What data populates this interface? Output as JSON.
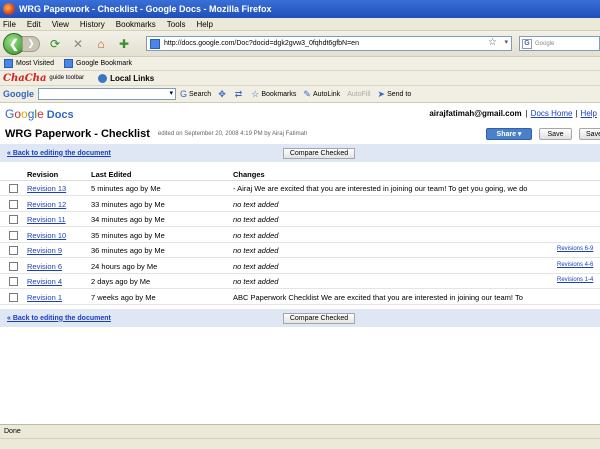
{
  "window": {
    "title": "WRG Paperwork - Checklist - Google Docs - Mozilla Firefox"
  },
  "menu": [
    "File",
    "Edit",
    "View",
    "History",
    "Bookmarks",
    "Tools",
    "Help"
  ],
  "nav": {
    "url": "http://docs.google.com/Doc?docid=dgk2gvw3_0fqhdt6gfbN=en",
    "search_placeholder": "Google"
  },
  "bookmarks": [
    "Most Visited",
    "Google Bookmark"
  ],
  "chacha": {
    "logo": "ChaCha",
    "subtitle": "guide toolbar",
    "local_links": "Local Links"
  },
  "google_toolbar": {
    "logo": "Google",
    "search": "Search",
    "bookmarks": "Bookmarks",
    "autolink": "AutoLink",
    "autofill": "AutoFill",
    "send_to": "Send to"
  },
  "docs_header": {
    "logo_letters": [
      "G",
      "o",
      "o",
      "g",
      "l",
      "e"
    ],
    "docs_label": "Docs",
    "user_email": "airajfatimah@gmail.com",
    "separator": "|",
    "docs_home": "Docs Home",
    "help": "Help"
  },
  "document": {
    "title": "WRG Paperwork - Checklist",
    "edited": "edited on September 20, 2008 4:19 PM by Airaj Fatimah",
    "share_label": "Share ▾",
    "save_label": "Save",
    "save_close_label": "Save"
  },
  "revisions": {
    "back_link": "« Back to editing the document",
    "compare_label": "Compare Checked",
    "headers": {
      "revision": "Revision",
      "last_edited": "Last Edited",
      "changes": "Changes"
    },
    "rows": [
      {
        "revision": "Revision 13",
        "edited": "5 minutes ago by Me",
        "changes": "- Airaj We are excited that you are interested in joining our team! To get you going, we do",
        "italic": false,
        "range": ""
      },
      {
        "revision": "Revision 12",
        "edited": "33 minutes ago by Me",
        "changes": "no text added",
        "italic": true,
        "range": ""
      },
      {
        "revision": "Revision 11",
        "edited": "34 minutes ago by Me",
        "changes": "no text added",
        "italic": true,
        "range": ""
      },
      {
        "revision": "Revision 10",
        "edited": "35 minutes ago by Me",
        "changes": "no text added",
        "italic": true,
        "range": ""
      },
      {
        "revision": "Revision 9",
        "edited": "36 minutes ago by Me",
        "changes": "no text added",
        "italic": true,
        "range": "Revisions 6-9"
      },
      {
        "revision": "Revision 6",
        "edited": "24 hours ago by Me",
        "changes": "no text added",
        "italic": true,
        "range": "Revisions 4-6"
      },
      {
        "revision": "Revision 4",
        "edited": "2 days ago by Me",
        "changes": "no text added",
        "italic": true,
        "range": "Revisions 1-4"
      },
      {
        "revision": "Revision 1",
        "edited": "7 weeks ago by Me",
        "changes": "ABC  Paperwork Checklist We are excited that you are interested in joining our team! To",
        "italic": false,
        "range": ""
      }
    ]
  },
  "status": {
    "text": "Done"
  }
}
